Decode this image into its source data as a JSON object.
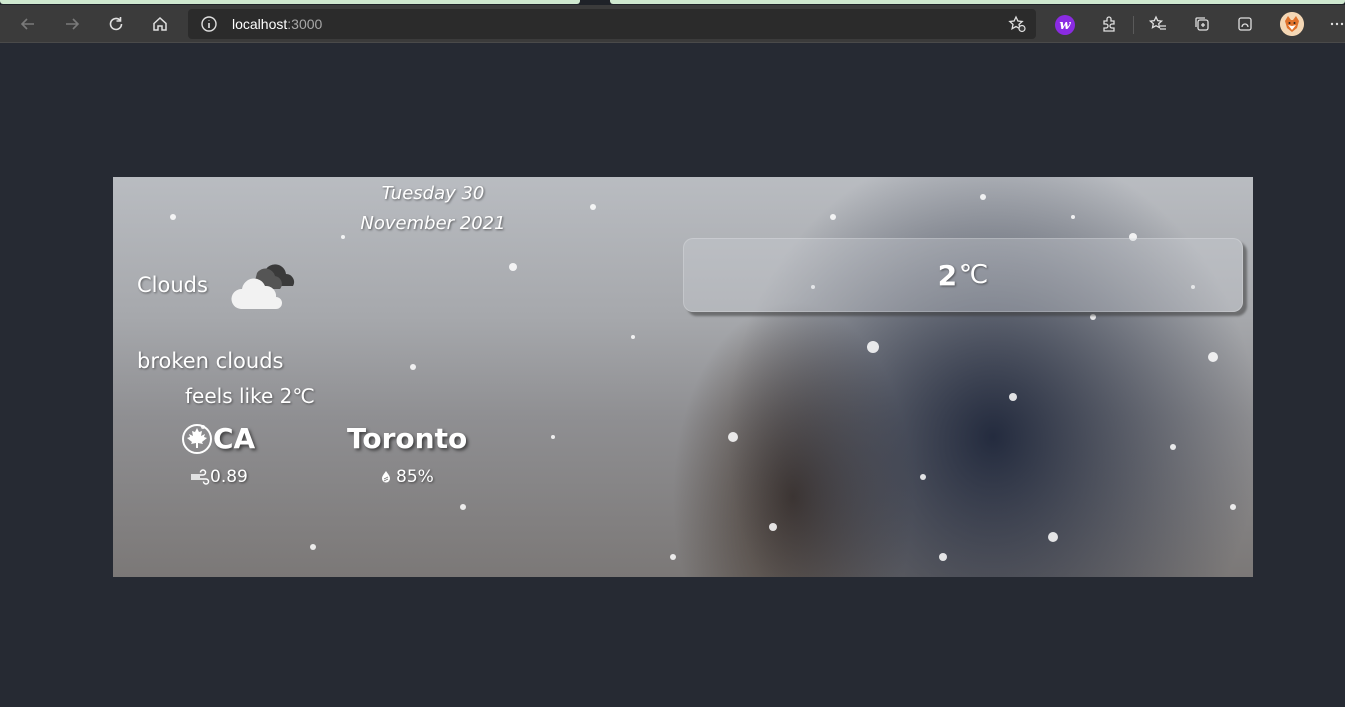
{
  "browser": {
    "url_host": "localhost",
    "url_port": ":3000"
  },
  "weather": {
    "date_line1": "Tuesday 30",
    "date_line2": "November 2021",
    "condition": "Clouds",
    "description": "broken clouds",
    "feels_like": "feels like 2℃",
    "country": "CA",
    "city": "Toronto",
    "wind": "0.89",
    "humidity": "85%",
    "temperature": "2",
    "temperature_unit": "℃",
    "condition_icon": "cloud-icon",
    "country_icon": "maple-leaf-icon",
    "wind_icon": "wind-icon",
    "humidity_icon": "droplet-icon"
  },
  "colors": {
    "page_background": "#262a33",
    "browser_toolbar": "#3b3b3b",
    "address_bar": "#2b2b2b"
  }
}
